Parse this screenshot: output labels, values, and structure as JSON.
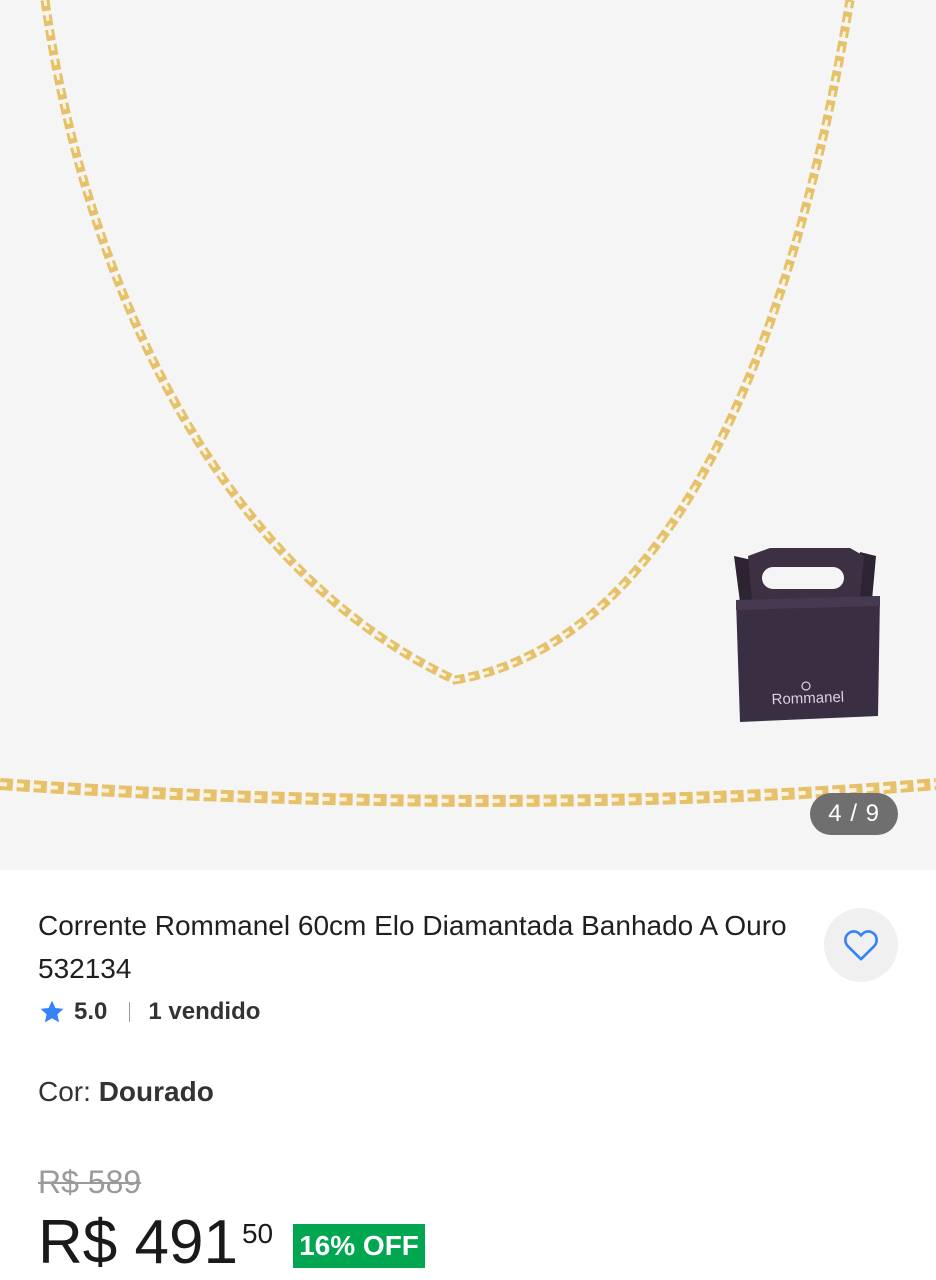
{
  "gallery": {
    "counter": "4 / 9",
    "box_brand": "Rommanel"
  },
  "product": {
    "title": "Corrente Rommanel 60cm Elo Diamantada Banhado A Ouro 532134",
    "rating": "5.0",
    "sold": "1 vendido",
    "color_label": "Cor:",
    "color_value": "Dourado",
    "old_price": "R$ 589",
    "price_main": "R$ 491",
    "price_cents": "50",
    "discount": "16% OFF"
  },
  "colors": {
    "accent": "#3483fa",
    "discount_bg": "#00a650",
    "gold": "#e8c46a"
  }
}
